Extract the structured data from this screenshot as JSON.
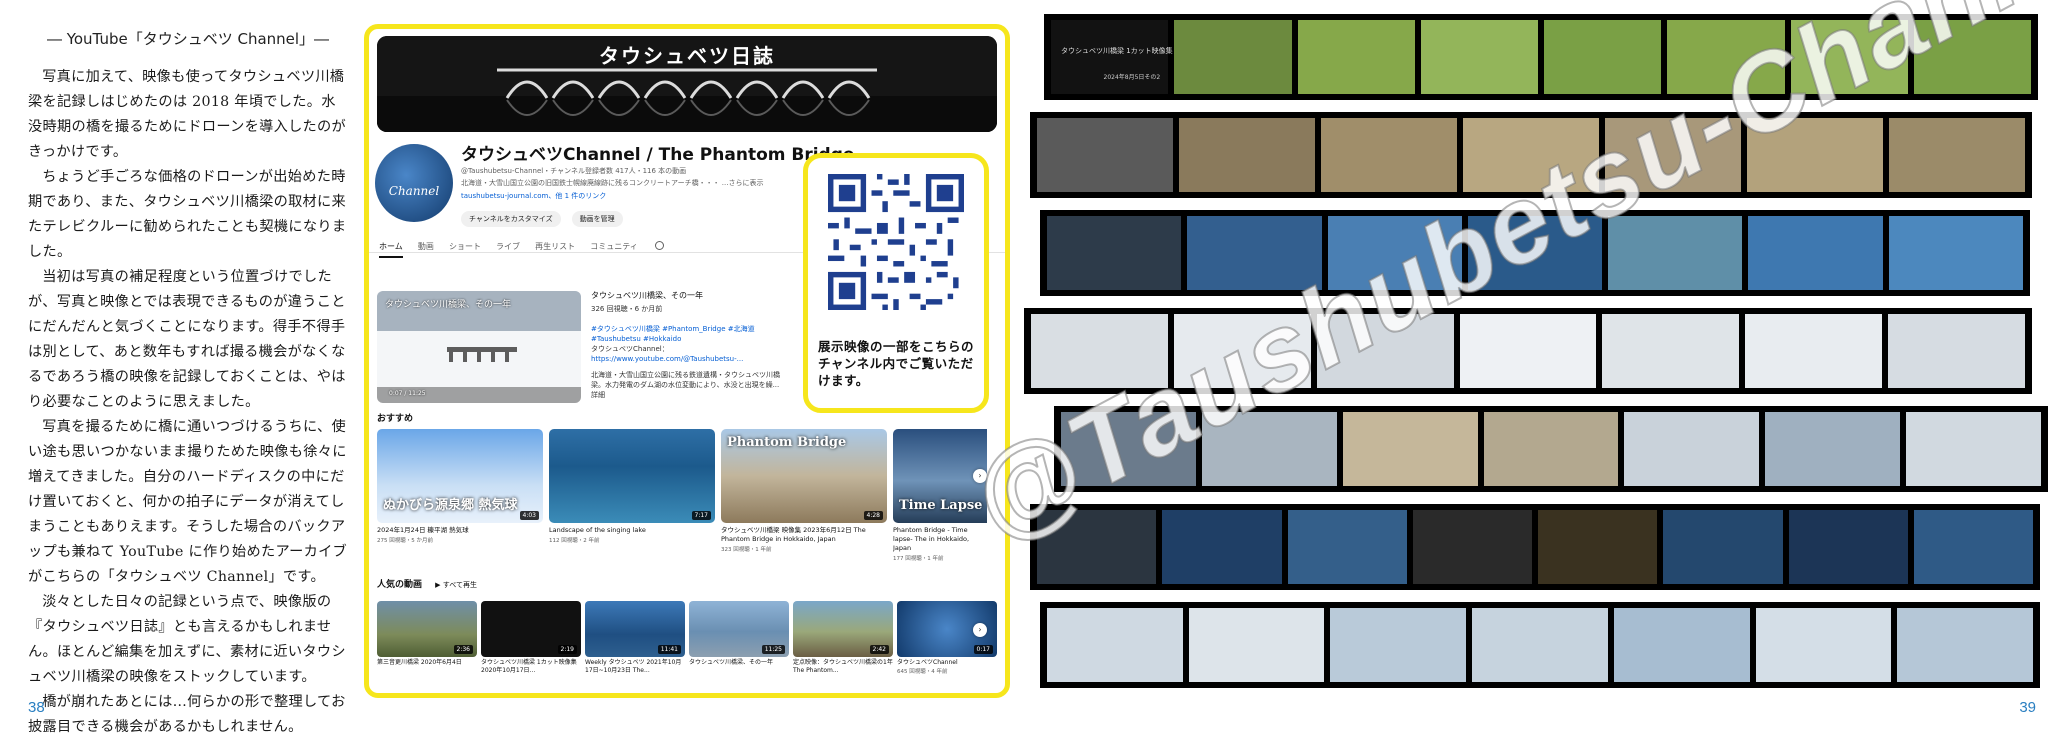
{
  "left_page": {
    "heading": "― YouTube「タウシュベツ Channel」―",
    "paragraphs": [
      "写真に加えて、映像も使ってタウシュベツ川橋梁を記録しはじめたのは 2018 年頃でした。水没時期の橋を撮るためにドローンを導入したのがきっかけです。",
      "ちょうど手ごろな価格のドローンが出始めた時期であり、また、タウシュベツ川橋梁の取材に来たテレビクルーに勧められたことも契機になりました。",
      "当初は写真の補足程度という位置づけでしたが、写真と映像とでは表現できるものが違うことにだんだんと気づくことになります。得手不得手は別として、あと数年もすれば撮る機会がなくなるであろう橋の映像を記録しておくことは、やはり必要なことのように思えました。",
      "写真を撮るために橋に通いつづけるうちに、使い途も思いつかないまま撮りためた映像も徐々に増えてきました。自分のハードディスクの中にだけ置いておくと、何かの拍子にデータが消えてしまうこともありえます。そうした場合のバックアップも兼ねて YouTube に作り始めたアーカイブがこちらの「タウシュベツ Channel」です。",
      "淡々とした日々の記録という点で、映像版の『タウシュベツ日誌』とも言えるかもしれません。ほとんど編集を加えずに、素材に近いタウシュベツ川橋梁の映像をストックしています。",
      "橋が崩れたあとには…何らかの形で整理してお披露目できる機会があるかもしれません。"
    ],
    "page_number": "38"
  },
  "right_page": {
    "page_number": "39"
  },
  "youtube": {
    "banner_title": "タウシュベツ日誌",
    "channel_name": "タウシュベツChannel / The Phantom Bridge",
    "channel_meta": "@Taushubetsu-Channel・チャンネル登録者数 417人・116 本の動画",
    "channel_desc": "北海道・大雪山国立公園の旧国鉄士幌線廃線跡に残るコンクリートアーチ橋・・・ ...さらに表示",
    "channel_link": "taushubetsu-journal.com、他 1 件のリンク",
    "avatar_text": "Channel",
    "buttons": [
      "チャンネルをカスタマイズ",
      "動画を管理"
    ],
    "tabs": [
      "ホーム",
      "動画",
      "ショート",
      "ライブ",
      "再生リスト",
      "コミュニティ"
    ],
    "featured": {
      "overlay_title": "タウシュベツ川橋梁、その一年",
      "time": "0:07 / 11:25",
      "title": "タウシュベツ川橋梁、その一年",
      "meta": "326 回視聴・6 か月前",
      "tags": "#タウシュベツ川橋梁 #Phantom_Bridge #北海道 #Taushubetsu #Hokkaido",
      "line1": "タウシュベツChannel：",
      "line2": "https://www.youtube.com/@Taushubetsu-...",
      "line3": "北海道・大雪山国立公園に残る鉄道遺構・タウシュベツ川橋梁。水力発電のダム湖の水位変動により、水没と出現を繰...",
      "more": "詳細"
    },
    "qr_caption": "展示映像の一部をこちらのチャンネル内でご覧いただけます。",
    "recommended_label": "おすすめ",
    "recommended": [
      {
        "title": "2024年1月24日 糠平湖 熱気球",
        "meta": "275 回視聴・5 か月前",
        "duration": "4:03",
        "overlay": "ぬかびら源泉郷 熱気球"
      },
      {
        "title": "Landscape of the singing lake",
        "meta": "112 回視聴・2 年前",
        "duration": "7:17",
        "overlay": ""
      },
      {
        "title": "タウシュベツ川橋梁 映像集 2023年6月12日 The Phantom Bridge in Hokkaido, Japan",
        "meta": "323 回視聴・1 年前",
        "duration": "4:28",
        "overlay": "Phantom Bridge"
      },
      {
        "title": "Phantom Bridge - Time lapse- The in Hokkaido, Japan",
        "meta": "177 回視聴・1 年前",
        "duration": "",
        "overlay": "Time Lapse"
      }
    ],
    "popular_label": "人気の動画",
    "play_all": "すべて再生",
    "popular": [
      {
        "title": "第三音更川橋梁 2020年6月4日",
        "meta": "",
        "duration": "2:36"
      },
      {
        "title": "タウシュベツ川橋梁 1カット映像集 2020年10月17日...",
        "meta": "",
        "duration": "2:19"
      },
      {
        "title": "Weekly タウシュベツ 2021年10月17日~10月23日 The...",
        "meta": "",
        "duration": "11:41"
      },
      {
        "title": "タウシュベツ川橋梁、その一年",
        "meta": "",
        "duration": "11:25"
      },
      {
        "title": "定点映像：タウシュベツ川橋梁の1年　The Phantom...",
        "meta": "",
        "duration": "2:42"
      },
      {
        "title": "タウシュベツChannel",
        "meta": "645 回視聴・4 年前",
        "duration": "0:17"
      }
    ]
  },
  "filmstrips": {
    "title_card_text": "タウシュベツ川橋梁 1カット映像集",
    "title_card_date": "2024年8月5日その2",
    "watermark": "@Taushubetsu-Channel"
  }
}
